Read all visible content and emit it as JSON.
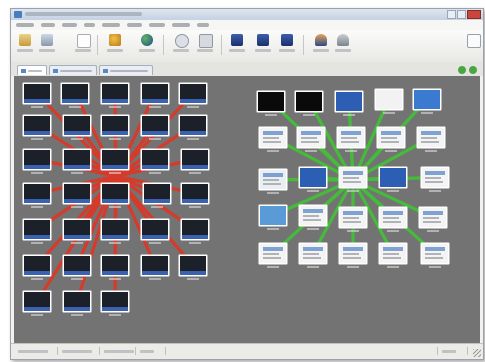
{
  "app": {
    "title": "",
    "menus": [],
    "tabs": [],
    "status": []
  },
  "colors": {
    "canvas": "#737373",
    "link_red": "#d63a2a",
    "link_green": "#45bb3a",
    "thumb_frame": "#ffffff",
    "thumb_dark": "#1c2028",
    "accent": "#4a7cc0"
  },
  "icons": [
    "app-icon",
    "new-icon",
    "open-icon",
    "save-icon",
    "users-icon",
    "globe-icon",
    "search-icon",
    "grab-icon",
    "monitor-icon",
    "monitor-add-icon",
    "monitor-group-icon",
    "person-icon",
    "person-gray-icon",
    "page-icon"
  ]
}
